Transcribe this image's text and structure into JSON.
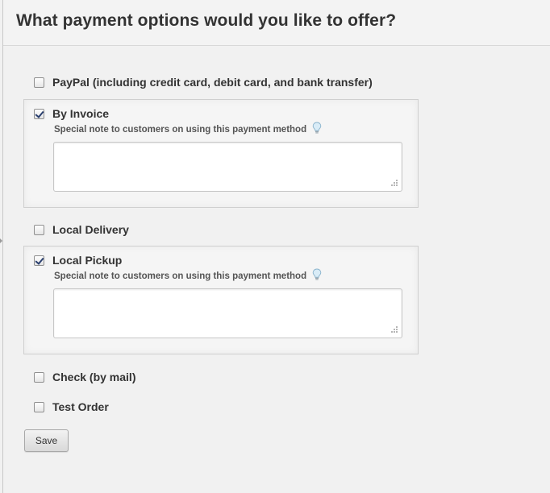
{
  "header": {
    "title": "What payment options would you like to offer?"
  },
  "options": [
    {
      "label": "PayPal (including credit card, debit card, and bank transfer)",
      "checked": false
    },
    {
      "label": "By Invoice",
      "checked": true,
      "note_label": "Special note to customers on using this payment method",
      "note_value": ""
    },
    {
      "label": "Local Delivery",
      "checked": false
    },
    {
      "label": "Local Pickup",
      "checked": true,
      "note_label": "Special note to customers on using this payment method",
      "note_value": ""
    },
    {
      "label": "Check (by mail)",
      "checked": false
    },
    {
      "label": "Test Order",
      "checked": false
    }
  ],
  "actions": {
    "save_label": "Save"
  },
  "icons": {
    "hint": "lightbulb-icon",
    "resize": "resize-grip-icon"
  }
}
